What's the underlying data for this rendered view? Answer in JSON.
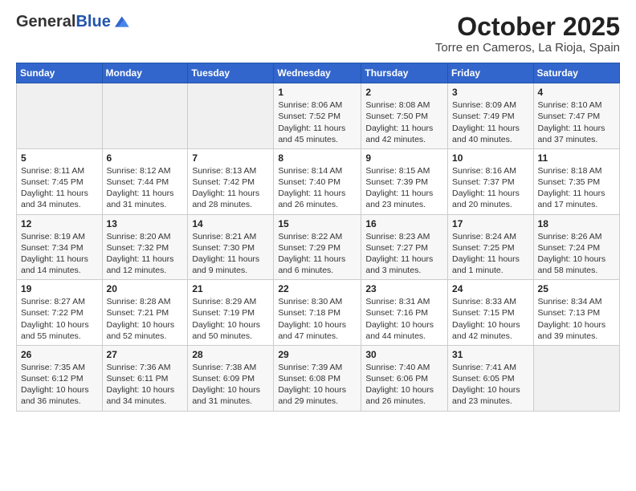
{
  "header": {
    "logo_general": "General",
    "logo_blue": "Blue",
    "title": "October 2025",
    "subtitle": "Torre en Cameros, La Rioja, Spain"
  },
  "calendar": {
    "columns": [
      "Sunday",
      "Monday",
      "Tuesday",
      "Wednesday",
      "Thursday",
      "Friday",
      "Saturday"
    ],
    "weeks": [
      [
        {
          "day": "",
          "info": ""
        },
        {
          "day": "",
          "info": ""
        },
        {
          "day": "",
          "info": ""
        },
        {
          "day": "1",
          "info": "Sunrise: 8:06 AM\nSunset: 7:52 PM\nDaylight: 11 hours and 45 minutes."
        },
        {
          "day": "2",
          "info": "Sunrise: 8:08 AM\nSunset: 7:50 PM\nDaylight: 11 hours and 42 minutes."
        },
        {
          "day": "3",
          "info": "Sunrise: 8:09 AM\nSunset: 7:49 PM\nDaylight: 11 hours and 40 minutes."
        },
        {
          "day": "4",
          "info": "Sunrise: 8:10 AM\nSunset: 7:47 PM\nDaylight: 11 hours and 37 minutes."
        }
      ],
      [
        {
          "day": "5",
          "info": "Sunrise: 8:11 AM\nSunset: 7:45 PM\nDaylight: 11 hours and 34 minutes."
        },
        {
          "day": "6",
          "info": "Sunrise: 8:12 AM\nSunset: 7:44 PM\nDaylight: 11 hours and 31 minutes."
        },
        {
          "day": "7",
          "info": "Sunrise: 8:13 AM\nSunset: 7:42 PM\nDaylight: 11 hours and 28 minutes."
        },
        {
          "day": "8",
          "info": "Sunrise: 8:14 AM\nSunset: 7:40 PM\nDaylight: 11 hours and 26 minutes."
        },
        {
          "day": "9",
          "info": "Sunrise: 8:15 AM\nSunset: 7:39 PM\nDaylight: 11 hours and 23 minutes."
        },
        {
          "day": "10",
          "info": "Sunrise: 8:16 AM\nSunset: 7:37 PM\nDaylight: 11 hours and 20 minutes."
        },
        {
          "day": "11",
          "info": "Sunrise: 8:18 AM\nSunset: 7:35 PM\nDaylight: 11 hours and 17 minutes."
        }
      ],
      [
        {
          "day": "12",
          "info": "Sunrise: 8:19 AM\nSunset: 7:34 PM\nDaylight: 11 hours and 14 minutes."
        },
        {
          "day": "13",
          "info": "Sunrise: 8:20 AM\nSunset: 7:32 PM\nDaylight: 11 hours and 12 minutes."
        },
        {
          "day": "14",
          "info": "Sunrise: 8:21 AM\nSunset: 7:30 PM\nDaylight: 11 hours and 9 minutes."
        },
        {
          "day": "15",
          "info": "Sunrise: 8:22 AM\nSunset: 7:29 PM\nDaylight: 11 hours and 6 minutes."
        },
        {
          "day": "16",
          "info": "Sunrise: 8:23 AM\nSunset: 7:27 PM\nDaylight: 11 hours and 3 minutes."
        },
        {
          "day": "17",
          "info": "Sunrise: 8:24 AM\nSunset: 7:25 PM\nDaylight: 11 hours and 1 minute."
        },
        {
          "day": "18",
          "info": "Sunrise: 8:26 AM\nSunset: 7:24 PM\nDaylight: 10 hours and 58 minutes."
        }
      ],
      [
        {
          "day": "19",
          "info": "Sunrise: 8:27 AM\nSunset: 7:22 PM\nDaylight: 10 hours and 55 minutes."
        },
        {
          "day": "20",
          "info": "Sunrise: 8:28 AM\nSunset: 7:21 PM\nDaylight: 10 hours and 52 minutes."
        },
        {
          "day": "21",
          "info": "Sunrise: 8:29 AM\nSunset: 7:19 PM\nDaylight: 10 hours and 50 minutes."
        },
        {
          "day": "22",
          "info": "Sunrise: 8:30 AM\nSunset: 7:18 PM\nDaylight: 10 hours and 47 minutes."
        },
        {
          "day": "23",
          "info": "Sunrise: 8:31 AM\nSunset: 7:16 PM\nDaylight: 10 hours and 44 minutes."
        },
        {
          "day": "24",
          "info": "Sunrise: 8:33 AM\nSunset: 7:15 PM\nDaylight: 10 hours and 42 minutes."
        },
        {
          "day": "25",
          "info": "Sunrise: 8:34 AM\nSunset: 7:13 PM\nDaylight: 10 hours and 39 minutes."
        }
      ],
      [
        {
          "day": "26",
          "info": "Sunrise: 7:35 AM\nSunset: 6:12 PM\nDaylight: 10 hours and 36 minutes."
        },
        {
          "day": "27",
          "info": "Sunrise: 7:36 AM\nSunset: 6:11 PM\nDaylight: 10 hours and 34 minutes."
        },
        {
          "day": "28",
          "info": "Sunrise: 7:38 AM\nSunset: 6:09 PM\nDaylight: 10 hours and 31 minutes."
        },
        {
          "day": "29",
          "info": "Sunrise: 7:39 AM\nSunset: 6:08 PM\nDaylight: 10 hours and 29 minutes."
        },
        {
          "day": "30",
          "info": "Sunrise: 7:40 AM\nSunset: 6:06 PM\nDaylight: 10 hours and 26 minutes."
        },
        {
          "day": "31",
          "info": "Sunrise: 7:41 AM\nSunset: 6:05 PM\nDaylight: 10 hours and 23 minutes."
        },
        {
          "day": "",
          "info": ""
        }
      ]
    ]
  }
}
